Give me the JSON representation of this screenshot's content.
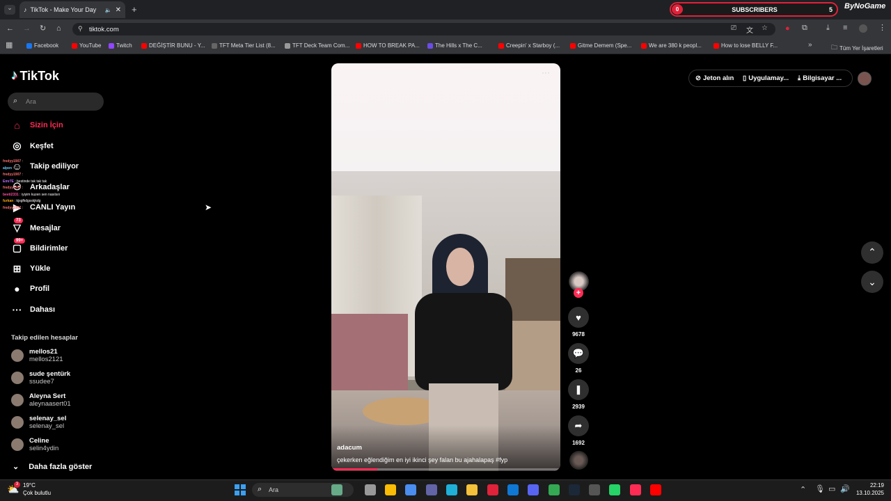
{
  "browser": {
    "tab_title": "TikTok - Make Your Day",
    "url": "tiktok.com",
    "new_tab": "+",
    "overlay": {
      "counter": "0",
      "label": "SUBSCRIBERS",
      "count": "5",
      "brand": "ByNoGame"
    },
    "bookmarks": [
      {
        "label": "Facebook",
        "color": "#1877f2"
      },
      {
        "label": "YouTube",
        "color": "#ff0000"
      },
      {
        "label": "Twitch",
        "color": "#9146ff"
      },
      {
        "label": "DEĞİŞTİR BUNU - Y...",
        "color": "#ff0000"
      },
      {
        "label": "TFT Meta Tier List (8...",
        "color": "#666"
      },
      {
        "label": "TFT Deck Team Com...",
        "color": "#999"
      },
      {
        "label": "HOW TO BREAK PA...",
        "color": "#ff0000"
      },
      {
        "label": "The Hills x The C...",
        "color": "#6b4de6"
      },
      {
        "label": "Creepin' x Starboy (...",
        "color": "#ff0000"
      },
      {
        "label": "Gitme Demem (Spe...",
        "color": "#ff0000"
      },
      {
        "label": "We are 380 k peopl...",
        "color": "#ff0000"
      },
      {
        "label": "How to lose BELLY F...",
        "color": "#ff0000"
      }
    ],
    "all_bookmarks": "Tüm Yer İşaretleri"
  },
  "tiktok": {
    "logo": "TikTok",
    "search_placeholder": "Ara",
    "nav": [
      {
        "label": "Sizin İçin",
        "icon": "home-icon",
        "active": true
      },
      {
        "label": "Keşfet",
        "icon": "compass-icon"
      },
      {
        "label": "Takip ediliyor",
        "icon": "following-icon"
      },
      {
        "label": "Arkadaşlar",
        "icon": "friends-icon"
      },
      {
        "label": "CANLI Yayın",
        "icon": "live-icon"
      },
      {
        "label": "Mesajlar",
        "icon": "message-icon",
        "badge": "73"
      },
      {
        "label": "Bildirimler",
        "icon": "notification-icon",
        "badge": "99+"
      },
      {
        "label": "Yükle",
        "icon": "upload-icon"
      },
      {
        "label": "Profil",
        "icon": "profile-icon"
      },
      {
        "label": "Dahası",
        "icon": "more-icon"
      }
    ],
    "following_title": "Takip edilen hesaplar",
    "following": [
      {
        "name": "mellos21",
        "handle": "mellos2121"
      },
      {
        "name": "sude şentürk",
        "handle": "ssudee7"
      },
      {
        "name": "Aleyna Sert",
        "handle": "aleynaasert01"
      },
      {
        "name": "selenay_sel",
        "handle": "selenay_sel"
      },
      {
        "name": "Celine",
        "handle": "selin4ydin"
      }
    ],
    "show_more": "Daha fazla göster",
    "top": {
      "coins": "Jeton alın",
      "app": "Uygulamay...",
      "desktop": "Bilgisayar ..."
    },
    "video": {
      "author": "adacum",
      "caption": "çekerken eğlendiğim en iyi ikinci şey falan bu ajahalapaş #fyp",
      "likes": "9678",
      "comments": "26",
      "saves": "2939",
      "shares": "1692",
      "progress": 0.2
    },
    "chat_overlay": [
      {
        "user": "fredyy1907",
        "text": ""
      },
      {
        "user": "alpen",
        "text": ""
      },
      {
        "user": "fredyy1907",
        "text": ""
      },
      {
        "user": "Emr7E",
        "text": "bestinde tak tak tak"
      },
      {
        "user": "fredyy1907",
        "text": ""
      },
      {
        "user": "beeti2331",
        "text": "iyiyim kuzen sen nasılsın"
      },
      {
        "user": "furkan",
        "text": "kjsgfkdgsskjkdg"
      },
      {
        "user": "fredyy1907",
        "text": ""
      }
    ]
  },
  "taskbar": {
    "temp": "19°C",
    "weather": "Çok bulutlu",
    "weather_badge": "3",
    "search": "Ara",
    "time": "22:19",
    "date": "13.10.2025"
  },
  "colors": {
    "accent": "#fe2c55",
    "bg": "#000000",
    "chrome": "#35363a"
  }
}
